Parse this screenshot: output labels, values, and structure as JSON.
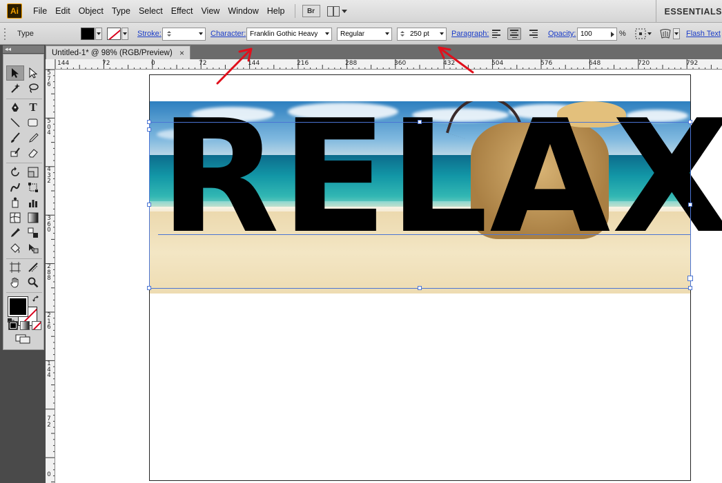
{
  "app": {
    "logo": "Ai",
    "menu": [
      "File",
      "Edit",
      "Object",
      "Type",
      "Select",
      "Effect",
      "View",
      "Window",
      "Help"
    ],
    "bridge_label": "Br",
    "workspace": "ESSENTIALS"
  },
  "control_bar": {
    "tool_label": "Type",
    "stroke_label": "Stroke:",
    "character_label": "Character:",
    "font_family": "Franklin Gothic Heavy",
    "font_style": "Regular",
    "font_size": "250 pt",
    "paragraph_label": "Paragraph:",
    "opacity_label": "Opacity:",
    "opacity_value": "100",
    "percent": "%",
    "flash_text_label": "Flash Text",
    "fill_color": "#000000"
  },
  "document": {
    "tab_title": "Untitled-1* @ 98% (RGB/Preview)",
    "close_glyph": "×",
    "panel_collapse_glyph": "◂◂"
  },
  "ruler": {
    "h_labels": [
      "144",
      "72",
      "0",
      "72",
      "144",
      "216",
      "288",
      "360",
      "432",
      "504",
      "576",
      "648",
      "720",
      "792"
    ],
    "v_labels": [
      [
        "5",
        "7",
        "6"
      ],
      [
        "5",
        "0",
        "4"
      ],
      [
        "4",
        "3",
        "2"
      ],
      [
        "3",
        "6",
        "0"
      ],
      [
        "2",
        "8",
        "8"
      ],
      [
        "2",
        "1",
        "6"
      ],
      [
        "1",
        "4",
        "4"
      ],
      [
        "7",
        "2"
      ],
      [
        "0"
      ]
    ]
  },
  "canvas": {
    "text_content": "RELAX"
  },
  "colors": {
    "accent_blue": "#1a3cc8",
    "selection_blue": "#4a74d4",
    "annotation_red": "#e0101c"
  }
}
